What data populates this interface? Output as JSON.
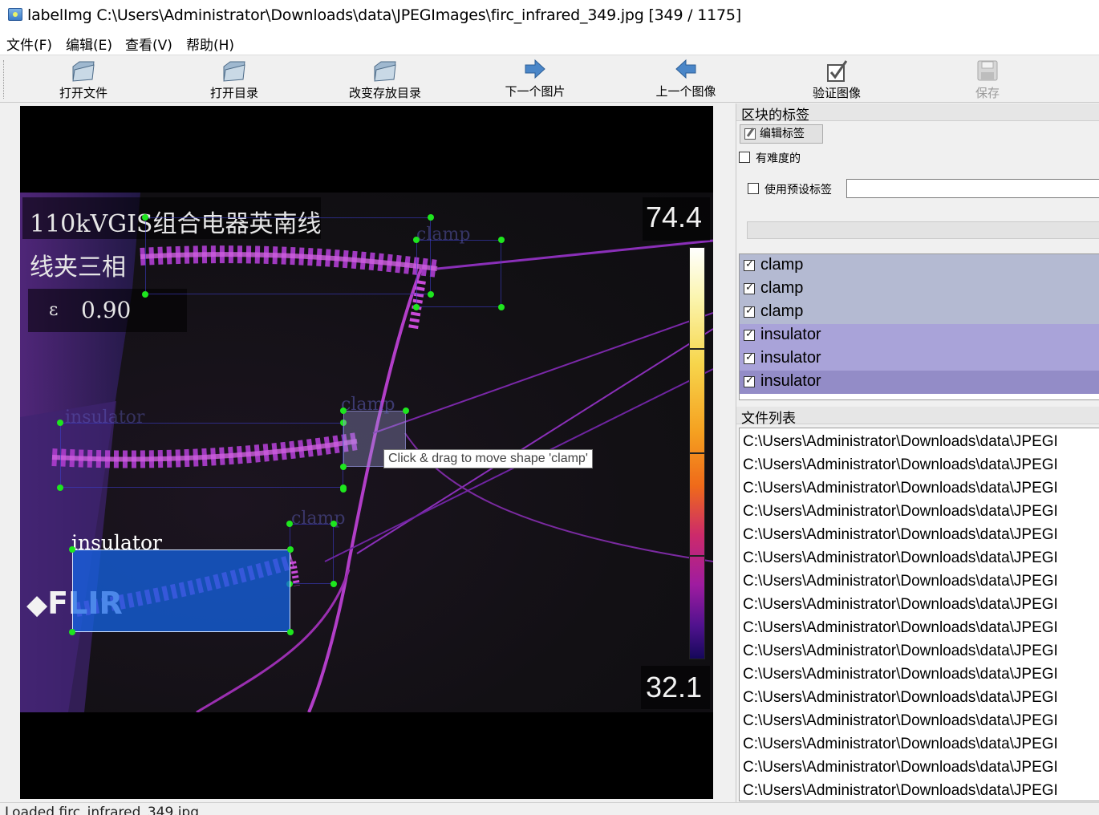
{
  "window": {
    "title": "labelImg C:\\Users\\Administrator\\Downloads\\data\\JPEGImages\\firc_infrared_349.jpg [349 / 1175]"
  },
  "menu": {
    "file": "文件(F)",
    "edit": "编辑(E)",
    "view": "查看(V)",
    "help": "帮助(H)"
  },
  "toolbar": {
    "open_file": "打开文件",
    "open_dir": "打开目录",
    "change_save_dir": "改变存放目录",
    "next_image": "下一个图片",
    "prev_image": "上一个图像",
    "verify_image": "验证图像",
    "save": "保存"
  },
  "image": {
    "hud_line1": "110kVGIS组合电器英南线",
    "hud_line2": "线夹三相",
    "emissivity_symbol": "ε",
    "emissivity_value": "0.90",
    "temp_max": "74.4",
    "temp_min": "32.1",
    "brand": "FLIR"
  },
  "shapes": [
    {
      "label": "clamp"
    },
    {
      "label": "insulator"
    },
    {
      "label": "clamp"
    },
    {
      "label": "clamp"
    },
    {
      "label": "insulator"
    }
  ],
  "tooltip": "Click & drag to move shape 'clamp'",
  "dock": {
    "box_labels_title": "区块的标签",
    "edit_label_button": "编辑标签",
    "difficult_label": "有难度的",
    "use_default_label": "使用预设标签",
    "default_label_value": "",
    "labels": [
      {
        "text": "clamp",
        "checked": true,
        "color": "#b4bad2"
      },
      {
        "text": "clamp",
        "checked": true,
        "color": "#b4bad2"
      },
      {
        "text": "clamp",
        "checked": true,
        "color": "#b4bad2"
      },
      {
        "text": "insulator",
        "checked": true,
        "color": "#a9a3d9"
      },
      {
        "text": "insulator",
        "checked": true,
        "color": "#a9a3d9"
      },
      {
        "text": "insulator",
        "checked": true,
        "color": "#938cc7"
      }
    ],
    "file_list_title": "文件列表",
    "files": [
      "C:\\Users\\Administrator\\Downloads\\data\\JPEGI",
      "C:\\Users\\Administrator\\Downloads\\data\\JPEGI",
      "C:\\Users\\Administrator\\Downloads\\data\\JPEGI",
      "C:\\Users\\Administrator\\Downloads\\data\\JPEGI",
      "C:\\Users\\Administrator\\Downloads\\data\\JPEGI",
      "C:\\Users\\Administrator\\Downloads\\data\\JPEGI",
      "C:\\Users\\Administrator\\Downloads\\data\\JPEGI",
      "C:\\Users\\Administrator\\Downloads\\data\\JPEGI",
      "C:\\Users\\Administrator\\Downloads\\data\\JPEGI",
      "C:\\Users\\Administrator\\Downloads\\data\\JPEGI",
      "C:\\Users\\Administrator\\Downloads\\data\\JPEGI",
      "C:\\Users\\Administrator\\Downloads\\data\\JPEGI",
      "C:\\Users\\Administrator\\Downloads\\data\\JPEGI",
      "C:\\Users\\Administrator\\Downloads\\data\\JPEGI",
      "C:\\Users\\Administrator\\Downloads\\data\\JPEGI",
      "C:\\Users\\Administrator\\Downloads\\data\\JPEGI"
    ]
  },
  "status": {
    "text": "Loaded firc_infrared_349.jpg"
  }
}
